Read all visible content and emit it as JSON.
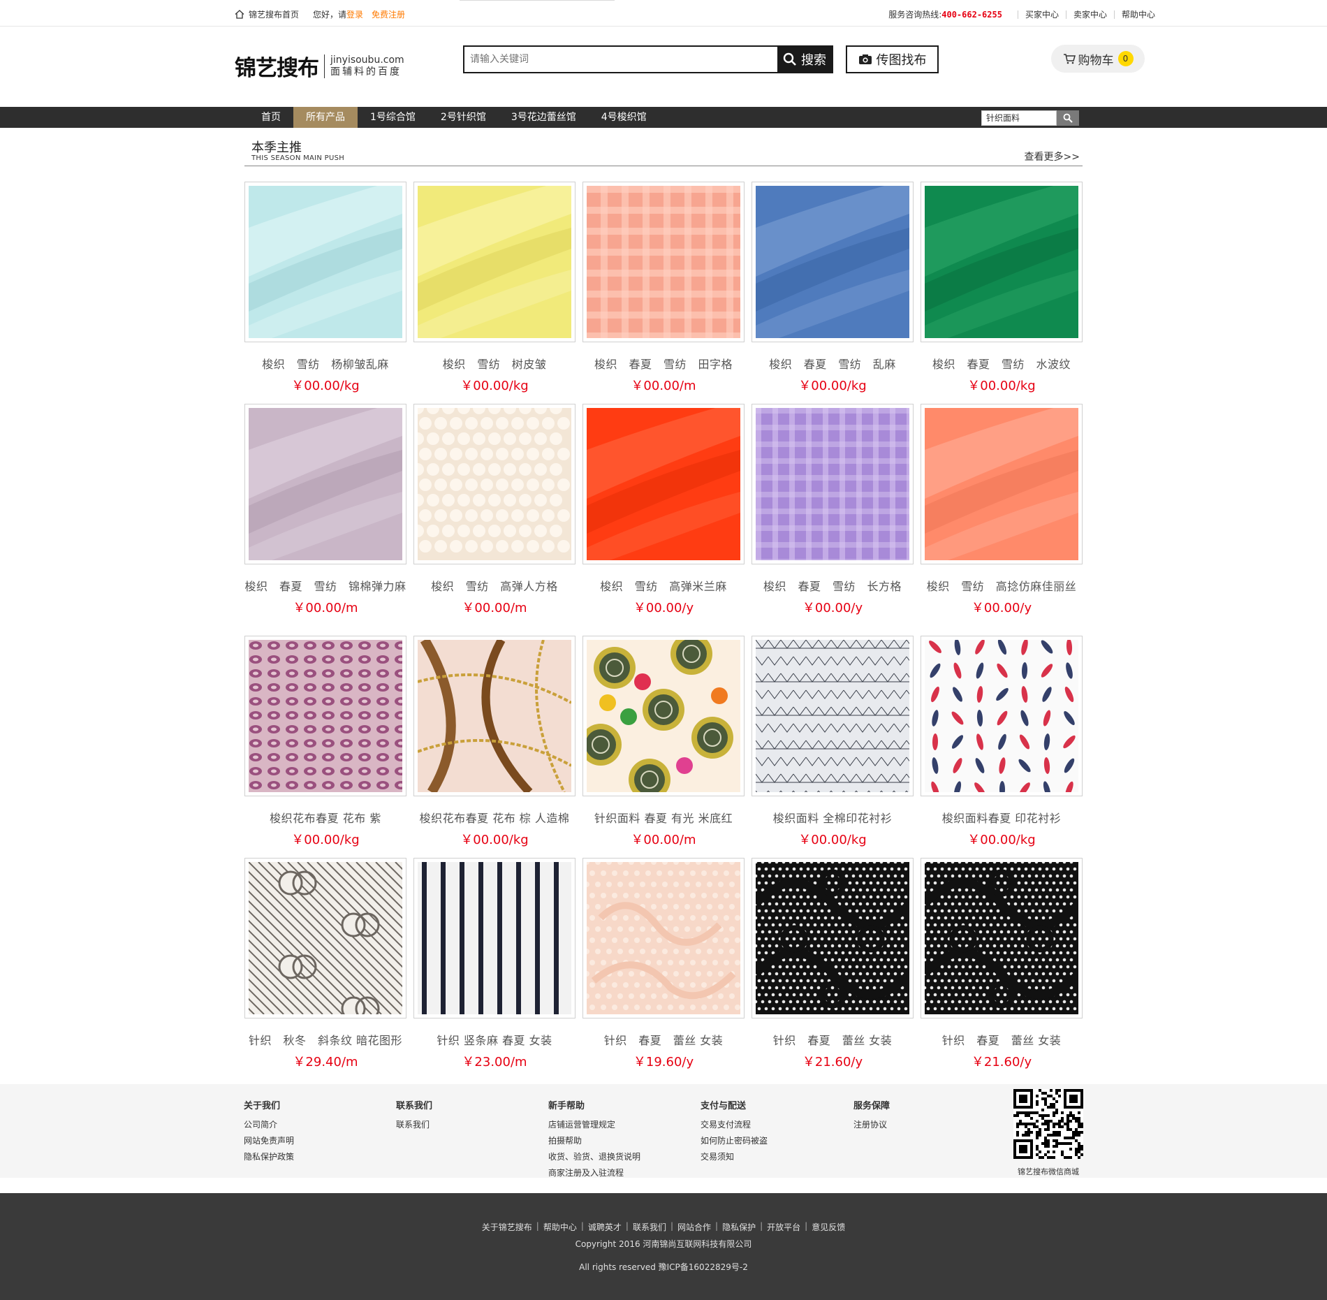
{
  "topbar": {
    "home_link": "锦艺搜布首页",
    "greeting": "您好，请",
    "login": "登录",
    "register": "免费注册",
    "hotline_label": "服务咨询热线:",
    "hotline": "400-662-6255",
    "links": [
      "买家中心",
      "卖家中心",
      "帮助中心"
    ]
  },
  "header": {
    "logo_text_a": "锦艺",
    "logo_text_b": "搜布",
    "logo_domain": "jinyisoubu.com",
    "logo_slogan": "面辅料的百度",
    "search_placeholder": "请输入关键词",
    "search_button": "搜索",
    "photo_search_button": "传图找布",
    "cart_label": "购物车",
    "cart_count": "0"
  },
  "nav": {
    "items": [
      "首页",
      "所有产品",
      "1号综合馆",
      "2号针织馆",
      "3号花边蕾丝馆",
      "4号梭织馆"
    ],
    "active_index": 1,
    "mini_search_value": "针织面料"
  },
  "section": {
    "title": "本季主推",
    "subtitle": "THIS SEASON MAIN PUSH",
    "more": "查看更多>>"
  },
  "products": [
    {
      "name": "梭织　雪纺　杨柳皱乱麻",
      "price": "￥00.00/kg",
      "swatch": "pale-aqua"
    },
    {
      "name": "梭织　雪纺　树皮皱",
      "price": "￥00.00/kg",
      "swatch": "yellow"
    },
    {
      "name": "梭织　春夏　雪纺　田字格",
      "price": "￥00.00/m",
      "swatch": "salmon-check"
    },
    {
      "name": "梭织　春夏　雪纺　乱麻",
      "price": "￥00.00/kg",
      "swatch": "blue"
    },
    {
      "name": "梭织　春夏　雪纺　水波纹",
      "price": "￥00.00/kg",
      "swatch": "green"
    },
    {
      "name": "梭织　春夏　雪纺　锦棉弹力麻",
      "price": "￥00.00/m",
      "swatch": "lilac"
    },
    {
      "name": "梭织　雪纺　高弹人方格",
      "price": "￥00.00/m",
      "swatch": "cream-waffle"
    },
    {
      "name": "梭织　雪纺　高弹米兰麻",
      "price": "￥00.00/y",
      "swatch": "orange-red"
    },
    {
      "name": "梭织　春夏　雪纺　长方格",
      "price": "￥00.00/y",
      "swatch": "purple-check"
    },
    {
      "name": "梭织　雪纺　高捻仿麻佳丽丝",
      "price": "￥00.00/y",
      "swatch": "coral"
    },
    {
      "name": "梭织花布春夏 花布 紫",
      "price": "￥00.00/kg",
      "swatch": "leopard-purple"
    },
    {
      "name": "梭织花布春夏 花布 棕 人造棉",
      "price": "￥00.00/kg",
      "swatch": "chain-brown"
    },
    {
      "name": "针织面料 春夏 有光 米底红",
      "price": "￥00.00/m",
      "swatch": "clock-print"
    },
    {
      "name": "梭织面料 全棉印花衬衫",
      "price": "￥00.00/kg",
      "swatch": "chevron-gray"
    },
    {
      "name": "梭织面料春夏 印花衬衫",
      "price": "￥00.00/kg",
      "swatch": "leaf-print"
    },
    {
      "name": "针织　秋冬　斜条纹 暗花图形",
      "price": "￥29.40/m",
      "swatch": "diagonal-logo"
    },
    {
      "name": "针织 竖条麻 春夏 女装",
      "price": "￥23.00/m",
      "swatch": "vertical-stripe"
    },
    {
      "name": "针织　春夏　蕾丝 女装",
      "price": "￥19.60/y",
      "swatch": "peach-lace"
    },
    {
      "name": "针织　春夏　蕾丝 女装",
      "price": "￥21.60/y",
      "swatch": "black-lace"
    },
    {
      "name": "针织　春夏　蕾丝 女装",
      "price": "￥21.60/y",
      "swatch": "black-lace"
    }
  ],
  "footer_columns": [
    {
      "title": "关于我们",
      "links": [
        "公司简介",
        "网站免责声明",
        "隐私保护政策"
      ]
    },
    {
      "title": "联系我们",
      "links": [
        "联系我们"
      ]
    },
    {
      "title": "新手帮助",
      "links": [
        "店铺运营管理规定",
        "拍摄帮助",
        "收货、验货、退换货说明",
        "商家注册及入驻流程"
      ]
    },
    {
      "title": "支付与配送",
      "links": [
        "交易支付流程",
        "如何防止密码被盗",
        "交易须知"
      ]
    },
    {
      "title": "服务保障",
      "links": [
        "注册协议"
      ]
    }
  ],
  "qr_label": "锦艺搜布微信商城",
  "footer": {
    "links": [
      "关于锦艺搜布",
      "帮助中心",
      "诚聘英才",
      "联系我们",
      "网站合作",
      "隐私保护",
      "开放平台",
      "意见反馈"
    ],
    "copyright": "Copyright 2016 河南锦尚互联网科技有限公司",
    "rights": "All rights reserved 豫ICP备16022829号-2"
  }
}
